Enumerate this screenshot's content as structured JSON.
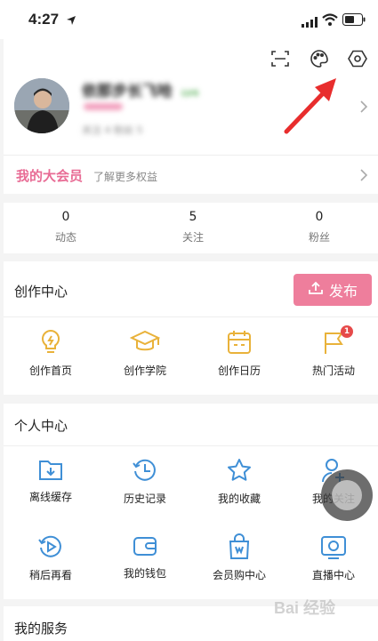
{
  "status_bar": {
    "time": "4:27"
  },
  "profile": {
    "username": "依那步长飞哈",
    "tag": "LV6",
    "level_badge": "LV6",
    "following_line": "关注 4    粉丝 5"
  },
  "vip": {
    "title": "我的大会员",
    "subtitle": "了解更多权益"
  },
  "stats": [
    {
      "value": "0",
      "label": "动态"
    },
    {
      "value": "5",
      "label": "关注"
    },
    {
      "value": "0",
      "label": "粉丝"
    }
  ],
  "creation_center": {
    "title": "创作中心",
    "publish_label": "发布",
    "items": [
      {
        "label": "创作首页",
        "icon": "lightbulb-icon"
      },
      {
        "label": "创作学院",
        "icon": "graduation-cap-icon"
      },
      {
        "label": "创作日历",
        "icon": "calendar-icon"
      },
      {
        "label": "热门活动",
        "icon": "flag-icon",
        "badge": "1"
      }
    ]
  },
  "personal_center": {
    "title": "个人中心",
    "items": [
      {
        "label": "离线缓存",
        "icon": "download-folder-icon"
      },
      {
        "label": "历史记录",
        "icon": "history-clock-icon"
      },
      {
        "label": "我的收藏",
        "icon": "star-icon"
      },
      {
        "label": "我的关注",
        "icon": "add-user-icon"
      },
      {
        "label": "稍后再看",
        "icon": "play-later-icon"
      },
      {
        "label": "我的钱包",
        "icon": "wallet-icon"
      },
      {
        "label": "会员购中心",
        "icon": "shopping-bag-icon"
      },
      {
        "label": "直播中心",
        "icon": "live-tv-icon"
      }
    ]
  },
  "services": {
    "title": "我的服务"
  },
  "watermark": "Bai 经验",
  "colors": {
    "accent": "#ee7e9c",
    "vip": "#e86c95",
    "icon_yellow": "#e9b23a",
    "icon_blue": "#3f8fd6",
    "badge": "#e64a4a"
  }
}
